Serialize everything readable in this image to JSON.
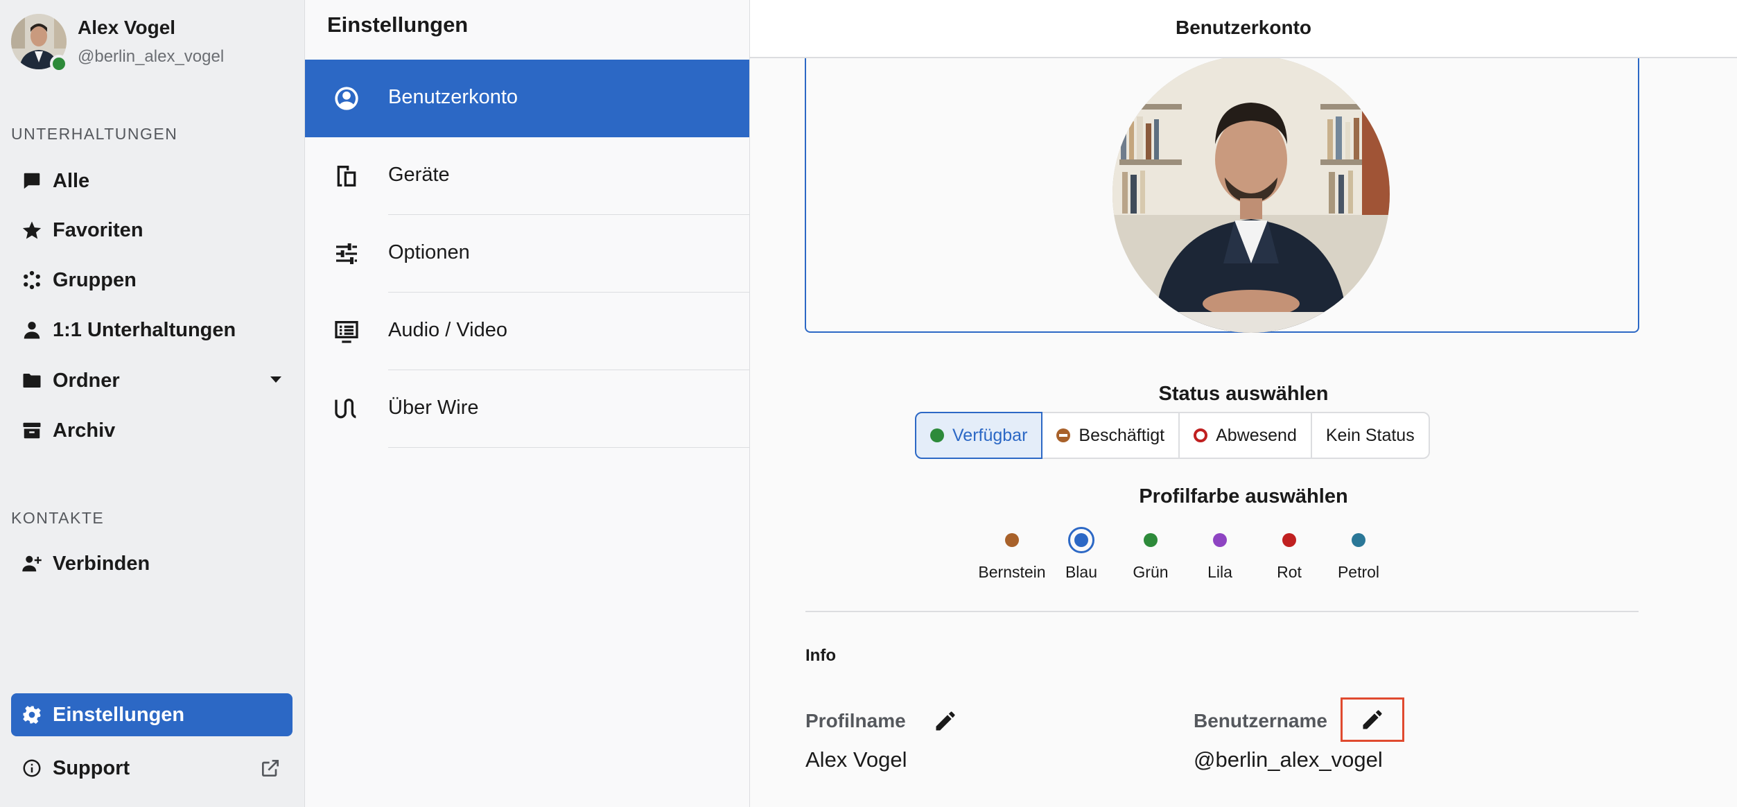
{
  "user": {
    "name": "Alex Vogel",
    "handle": "@berlin_alex_vogel"
  },
  "sidebar": {
    "conversations_label": "UNTERHALTUNGEN",
    "items": [
      {
        "label": "Alle",
        "icon": "chat-bubble-icon"
      },
      {
        "label": "Favoriten",
        "icon": "star-icon"
      },
      {
        "label": "Gruppen",
        "icon": "group-dots-icon"
      },
      {
        "label": "1:1 Unterhaltungen",
        "icon": "person-icon"
      },
      {
        "label": "Ordner",
        "icon": "folder-icon"
      },
      {
        "label": "Archiv",
        "icon": "archive-icon"
      }
    ],
    "contacts_label": "KONTAKTE",
    "connect_label": "Verbinden",
    "settings_label": "Einstellungen",
    "support_label": "Support"
  },
  "settings": {
    "title": "Einstellungen",
    "items": [
      {
        "label": "Benutzerkonto",
        "icon": "account-circle-icon"
      },
      {
        "label": "Geräte",
        "icon": "devices-icon"
      },
      {
        "label": "Optionen",
        "icon": "sliders-icon"
      },
      {
        "label": "Audio / Video",
        "icon": "av-icon"
      },
      {
        "label": "Über Wire",
        "icon": "wire-logo-icon"
      }
    ]
  },
  "main": {
    "title": "Benutzerkonto",
    "status_heading": "Status auswählen",
    "status_options": [
      "Verfügbar",
      "Beschäftigt",
      "Abwesend",
      "Kein Status"
    ],
    "color_heading": "Profilfarbe auswählen",
    "colors": [
      {
        "label": "Bernstein",
        "hex": "#a8612a"
      },
      {
        "label": "Blau",
        "hex": "#2c68c5"
      },
      {
        "label": "Grün",
        "hex": "#2d8a3a"
      },
      {
        "label": "Lila",
        "hex": "#8e44c2"
      },
      {
        "label": "Rot",
        "hex": "#c02020"
      },
      {
        "label": "Petrol",
        "hex": "#2a7797"
      }
    ],
    "selected_color": "Blau",
    "info_label": "Info",
    "profile_name_label": "Profilname",
    "profile_name_value": "Alex Vogel",
    "username_label": "Benutzername",
    "username_value": "@berlin_alex_vogel"
  },
  "colors": {
    "accent": "#2c68c5",
    "status_available": "#2d8a3a",
    "highlight": "#e04a2f"
  }
}
